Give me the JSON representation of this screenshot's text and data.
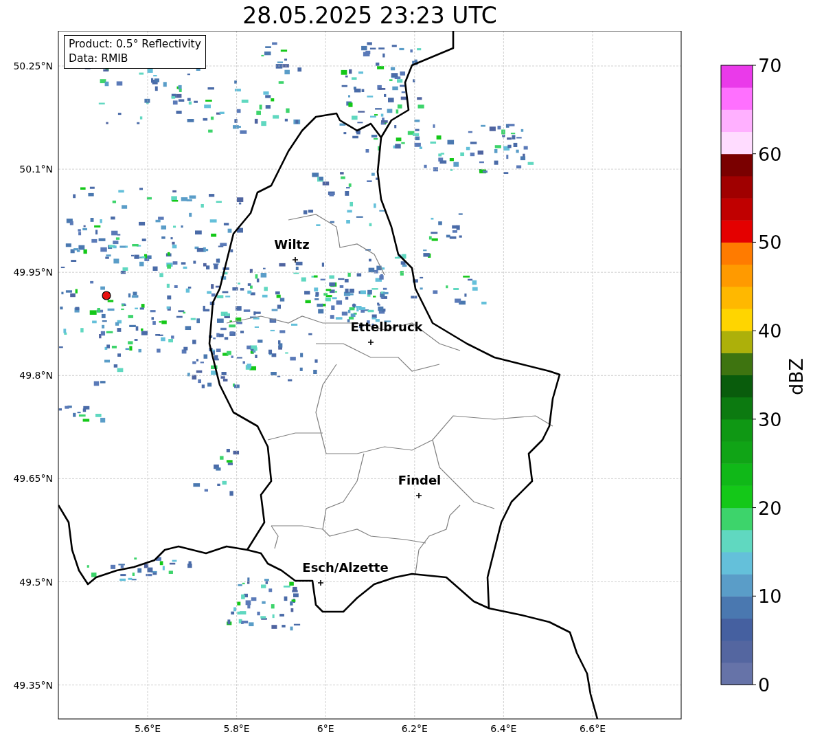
{
  "title": "28.05.2025 23:23 UTC",
  "info_box": {
    "lines": [
      "Product: 0.5° Reflectivity",
      "Data: RMIB"
    ]
  },
  "map": {
    "y_ticks": [
      "50.25°N",
      "50.1°N",
      "49.95°N",
      "49.8°N",
      "49.65°N",
      "49.5°N",
      "49.35°N"
    ],
    "x_ticks": [
      "5.6°E",
      "5.8°E",
      "6°E",
      "6.2°E",
      "6.4°E",
      "6.6°E"
    ],
    "cities": [
      {
        "name": "Wiltz"
      },
      {
        "name": "Ettelbruck"
      },
      {
        "name": "Findel"
      },
      {
        "name": "Esch/Alzette"
      }
    ]
  },
  "colorbar": {
    "label": "dBZ",
    "ticks": [
      "70",
      "60",
      "50",
      "40",
      "30",
      "20",
      "10",
      "0"
    ],
    "bands": [
      {
        "color": "#6673a8"
      },
      {
        "color": "#5466a0"
      },
      {
        "color": "#4560a0"
      },
      {
        "color": "#4a78b0"
      },
      {
        "color": "#5a9dc8"
      },
      {
        "color": "#64c0da"
      },
      {
        "color": "#60d8c0"
      },
      {
        "color": "#3dd46b"
      },
      {
        "color": "#14c818"
      },
      {
        "color": "#10b818"
      },
      {
        "color": "#10a416"
      },
      {
        "color": "#0f9814"
      },
      {
        "color": "#0c7a10"
      },
      {
        "color": "#095c0c"
      },
      {
        "color": "#3e7410"
      },
      {
        "color": "#adb00a"
      },
      {
        "color": "#ffd500"
      },
      {
        "color": "#ffb800"
      },
      {
        "color": "#ff9a00"
      },
      {
        "color": "#ff7b00"
      },
      {
        "color": "#e40000"
      },
      {
        "color": "#c00000"
      },
      {
        "color": "#a00000"
      },
      {
        "color": "#7a0000"
      },
      {
        "color": "#ffdcff"
      },
      {
        "color": "#ffb0ff"
      },
      {
        "color": "#ff70ff"
      },
      {
        "color": "#ea3aea"
      }
    ]
  }
}
